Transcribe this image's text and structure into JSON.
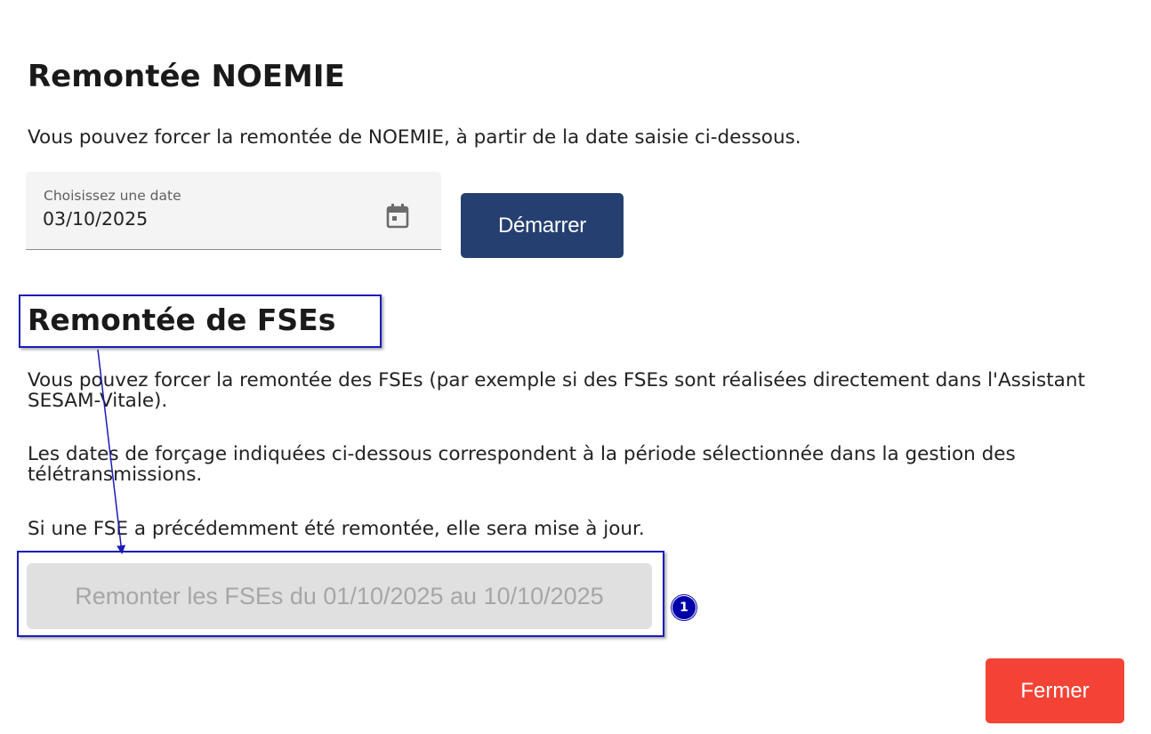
{
  "noemie": {
    "title": "Remontée NOEMIE",
    "description": "Vous pouvez forcer la remontée de NOEMIE, à partir de la date saisie ci-dessous.",
    "date_label": "Choisissez une date",
    "date_value": "03/10/2025",
    "calendar_icon": "calendar-icon",
    "start_label": "Démarrer"
  },
  "fse": {
    "title": "Remontée de FSEs",
    "description_1": "Vous pouvez forcer la remontée des FSEs (par exemple si des FSEs sont réalisées directement dans l'Assistant SESAM-Vitale).",
    "description_2": "Les dates de forçage indiquées ci-dessous correspondent à la période sélectionnée dans la gestion des télétransmissions.",
    "description_3": "Si une FSE a précédemment été remontée, elle sera mise à jour.",
    "remonter_label": "Remonter les FSEs du 01/10/2025 au 10/10/2025",
    "remonter_disabled": true
  },
  "footer": {
    "close_label": "Fermer"
  },
  "annotation": {
    "badge_number": "1"
  },
  "colors": {
    "primary": "#253f70",
    "danger": "#f44336",
    "disabled_bg": "#e0e0e0",
    "disabled_text": "#a6a6a6",
    "annotation": "#1b1bb8"
  }
}
